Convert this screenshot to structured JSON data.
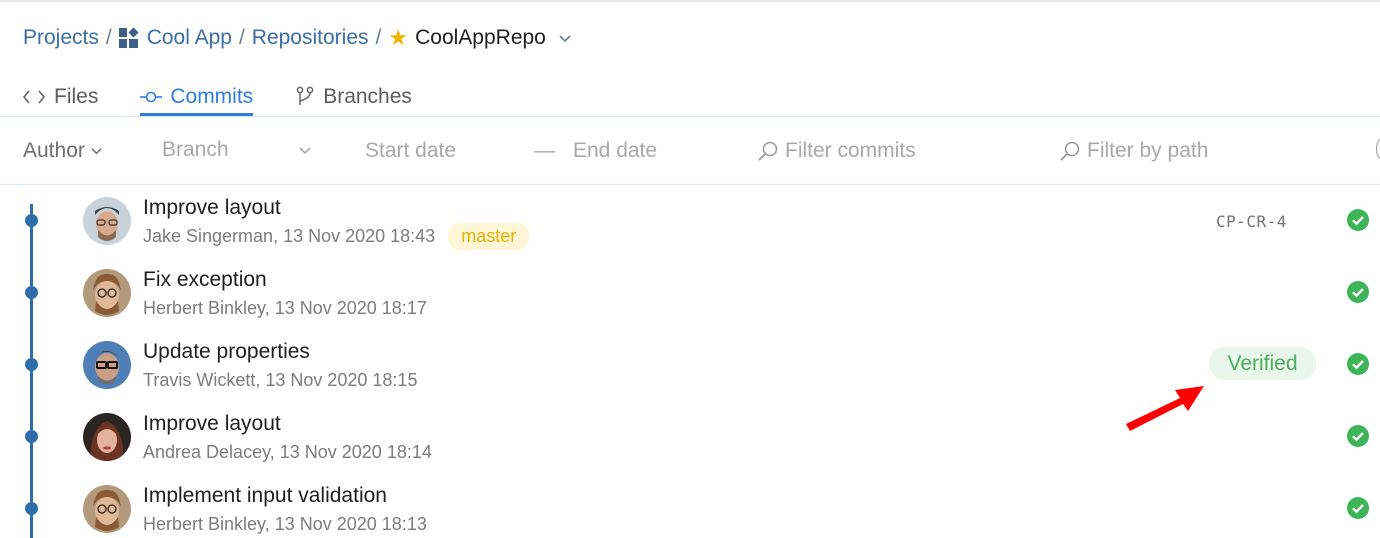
{
  "breadcrumb": {
    "projects": "Projects",
    "sep": "/",
    "app": "Cool App",
    "repositories": "Repositories",
    "repo": "CoolAppRepo",
    "icons": {
      "app": "grid-app-icon",
      "star": "star-icon",
      "chevron": "chevron-down-icon"
    }
  },
  "tabs": [
    {
      "label": "Files",
      "icon": "code-icon",
      "active": false
    },
    {
      "label": "Commits",
      "icon": "commit-icon",
      "active": true
    },
    {
      "label": "Branches",
      "icon": "branch-icon",
      "active": false
    }
  ],
  "filters": {
    "author": "Author",
    "branch_placeholder": "Branch",
    "start_date_placeholder": "Start date",
    "date_separator": "—",
    "end_date_placeholder": "End date",
    "filter_commits_placeholder": "Filter commits",
    "filter_path_placeholder": "Filter by path"
  },
  "commits": [
    {
      "title": "Improve layout",
      "meta": "Jake Singerman, 13 Nov 2020 18:43",
      "branch": "master",
      "issue": "CP-CR-4",
      "status": "success"
    },
    {
      "title": "Fix exception",
      "meta": "Herbert Binkley, 13 Nov 2020 18:17",
      "status": "success"
    },
    {
      "title": "Update properties",
      "meta": "Travis Wickett, 13 Nov 2020 18:15",
      "badge": "Verified",
      "status": "success"
    },
    {
      "title": "Improve layout",
      "meta": "Andrea Delacey, 13 Nov 2020 18:14",
      "status": "success"
    },
    {
      "title": "Implement input validation",
      "meta": "Herbert Binkley, 13 Nov 2020 18:13",
      "status": "success"
    }
  ],
  "colors": {
    "link": "#3a6ea5",
    "accent": "#2f7de1",
    "timeline": "#2e6fa9",
    "success": "#3fb55a",
    "branch_badge_bg": "#fff6d8",
    "branch_badge_text": "#e8b100",
    "verified_bg": "#e9f6ec",
    "annotation_arrow": "#ff0000"
  }
}
